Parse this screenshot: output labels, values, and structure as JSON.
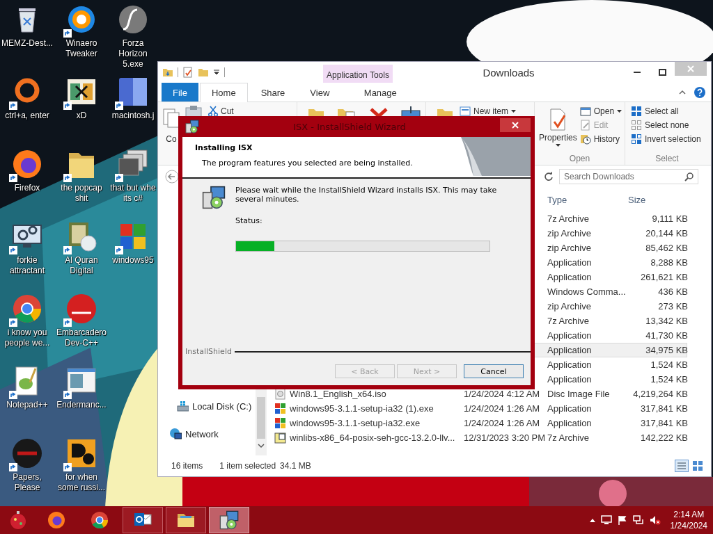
{
  "desktop_icons": [
    {
      "label": "MEMZ-Dest...",
      "kind": "bin",
      "shortcut": false
    },
    {
      "label": "ctrl+a, enter",
      "kind": "ring",
      "shortcut": true
    },
    {
      "label": "Firefox",
      "kind": "firefox",
      "shortcut": true
    },
    {
      "label": "forkie attractant",
      "kind": "monitor",
      "shortcut": true
    },
    {
      "label": "i know you people we...",
      "kind": "chrome",
      "shortcut": true
    },
    {
      "label": "Notepad++",
      "kind": "notepad",
      "shortcut": true
    },
    {
      "label": "Papers, Please",
      "kind": "papers",
      "shortcut": true
    },
    {
      "label": "Winaero Tweaker",
      "kind": "swirl",
      "shortcut": true
    },
    {
      "label": "xD",
      "kind": "tile",
      "shortcut": true
    },
    {
      "label": "the popcap shit",
      "kind": "folder",
      "shortcut": true
    },
    {
      "label": "Al Quran Digital",
      "kind": "book",
      "shortcut": true
    },
    {
      "label": "Embarcadero Dev-C++",
      "kind": "redcircle",
      "shortcut": true
    },
    {
      "label": "Endermanc...",
      "kind": "window",
      "shortcut": true
    },
    {
      "label": "for when some russi...",
      "kind": "de",
      "shortcut": true
    },
    {
      "label": "Forza Horizon 5.exe",
      "kind": "sphere",
      "shortcut": false
    },
    {
      "label": "macintosh.j",
      "kind": "split",
      "shortcut": true
    },
    {
      "label": "that but whe its c#",
      "kind": "stack",
      "shortcut": true
    },
    {
      "label": "windows95",
      "kind": "flag",
      "shortcut": true
    }
  ],
  "explorer": {
    "title": "Downloads",
    "contextual_tab": "Application Tools",
    "tabs": [
      {
        "label": "File",
        "kind": "file",
        "selected": false
      },
      {
        "label": "Home",
        "kind": "tab",
        "selected": true
      },
      {
        "label": "Share",
        "kind": "tab",
        "selected": false
      },
      {
        "label": "View",
        "kind": "tab",
        "selected": false
      },
      {
        "label": "Manage",
        "kind": "tab",
        "selected": false
      }
    ],
    "ribbon": {
      "copy": "Co",
      "cut": "Cut",
      "new_item": "New item",
      "properties": "Properties",
      "open_items": [
        {
          "label": "Open",
          "disabled": false,
          "dropdown": true
        },
        {
          "label": "Edit",
          "disabled": true,
          "dropdown": false
        },
        {
          "label": "History",
          "disabled": false,
          "dropdown": false
        }
      ],
      "open_group": "Open",
      "select_items": [
        "Select all",
        "Select none",
        "Invert selection"
      ],
      "select_group": "Select"
    },
    "search": {
      "placeholder": "Search Downloads"
    },
    "columns": [
      "Type",
      "Size"
    ],
    "nav": [
      {
        "label": "Local Disk (C:)",
        "kind": "drive"
      },
      {
        "label": "Network",
        "kind": "network"
      }
    ],
    "files": [
      {
        "type": "7z Archive",
        "size": "9,111 KB",
        "selected": false
      },
      {
        "type": "zip Archive",
        "size": "20,144 KB",
        "selected": false
      },
      {
        "type": "zip Archive",
        "size": "85,462 KB",
        "selected": false
      },
      {
        "type": "Application",
        "size": "8,288 KB",
        "selected": false
      },
      {
        "type": "Application",
        "size": "261,621 KB",
        "selected": false
      },
      {
        "type": "Windows Comma...",
        "size": "436 KB",
        "selected": false
      },
      {
        "type": "zip Archive",
        "size": "273 KB",
        "selected": false
      },
      {
        "type": "7z Archive",
        "size": "13,342 KB",
        "selected": false
      },
      {
        "type": "Application",
        "size": "41,730 KB",
        "selected": false
      },
      {
        "type": "Application",
        "size": "34,975 KB",
        "selected": true
      },
      {
        "type": "Application",
        "size": "1,524 KB",
        "selected": false
      },
      {
        "type": "Application",
        "size": "1,524 KB",
        "selected": false
      },
      {
        "name": "Win8.1_English_x64.iso",
        "modified": "1/24/2024 4:12 AM",
        "type": "Disc Image File",
        "size": "4,219,264 KB",
        "kind": "disc",
        "selected": false
      },
      {
        "name": "windows95-3.1.1-setup-ia32 (1).exe",
        "modified": "1/24/2024 1:26 AM",
        "type": "Application",
        "size": "317,841 KB",
        "kind": "windows",
        "selected": false
      },
      {
        "name": "windows95-3.1.1-setup-ia32.exe",
        "modified": "1/24/2024 1:26 AM",
        "type": "Application",
        "size": "317,841 KB",
        "kind": "windows",
        "selected": false
      },
      {
        "name": "winlibs-x86_64-posix-seh-gcc-13.2.0-llv...",
        "modified": "12/31/2023 3:20 PM",
        "type": "7z Archive",
        "size": "142,222 KB",
        "kind": "archive",
        "selected": false
      }
    ],
    "status": {
      "count": "16 items",
      "selection": "1 item selected",
      "size": "34.1 MB"
    }
  },
  "dialog": {
    "title": "ISX - InstallShield Wizard",
    "heading": "Installing ISX",
    "subheading": "The program features you selected are being installed.",
    "message": "Please wait while the InstallShield Wizard installs ISX. This may take several minutes.",
    "status_label": "Status:",
    "progress": {
      "level": 0.15
    },
    "brand": "InstallShield",
    "buttons": [
      {
        "label": "< Back",
        "disabled": true,
        "default": false
      },
      {
        "label": "Next >",
        "disabled": true,
        "default": false
      },
      {
        "label": "Cancel",
        "disabled": false,
        "default": true
      }
    ]
  },
  "taskbar": {
    "apps": [
      {
        "kind": "firefox",
        "running": false,
        "active": false
      },
      {
        "kind": "chrome",
        "running": false,
        "active": false
      },
      {
        "kind": "outlook",
        "running": true,
        "active": false
      },
      {
        "kind": "explorer",
        "running": true,
        "active": false
      },
      {
        "kind": "installer",
        "running": true,
        "active": true
      }
    ],
    "time": "2:14 AM",
    "date": "1/24/2024"
  }
}
